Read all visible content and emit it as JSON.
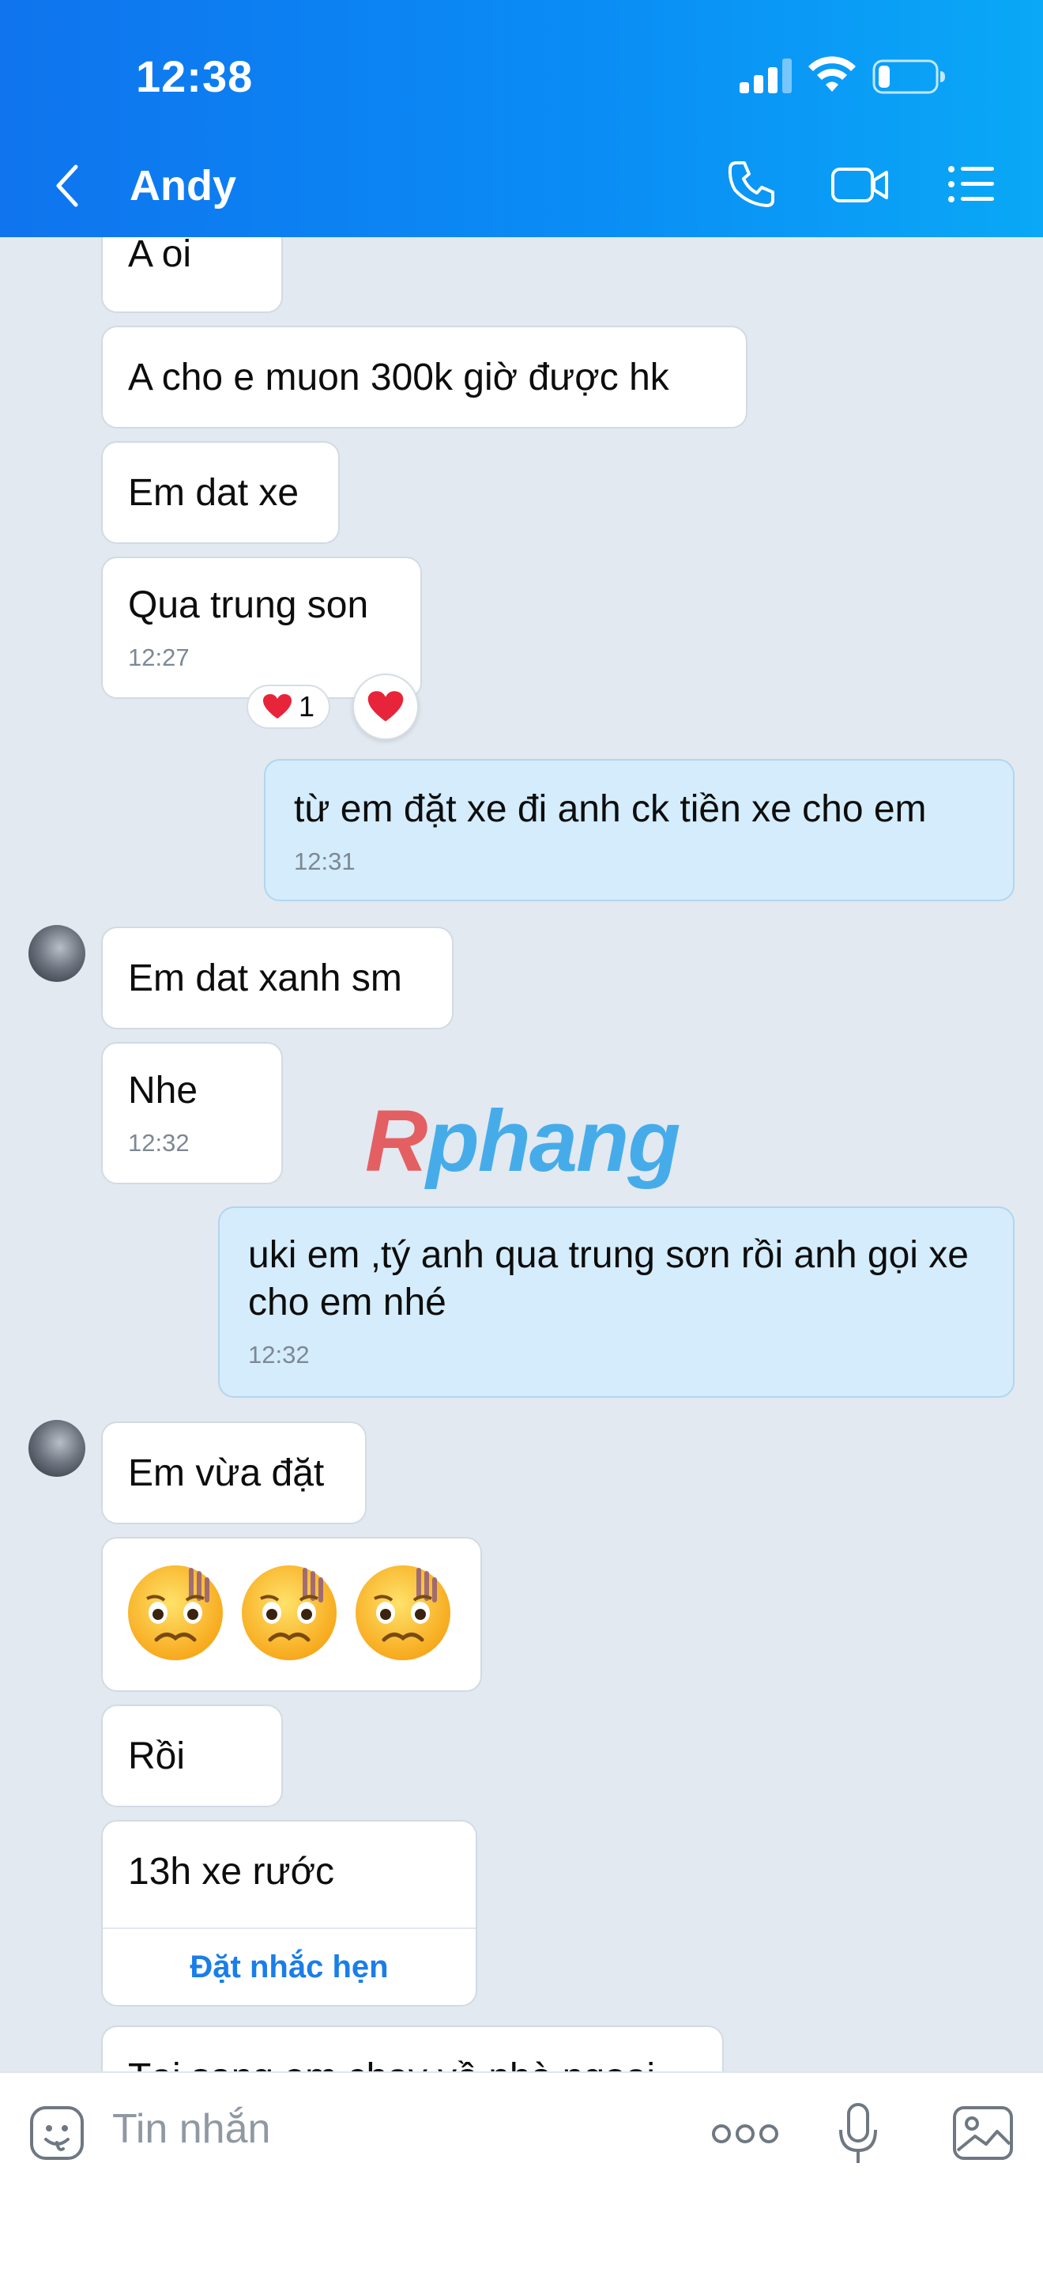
{
  "status_bar": {
    "time": "12:38"
  },
  "header": {
    "contact_name": "Andy"
  },
  "messages": [
    {
      "text": "A oi"
    },
    {
      "text": "A cho e muon 300k giờ được hk"
    },
    {
      "text": "Em dat xe"
    },
    {
      "text": "Qua trung son",
      "time": "12:27",
      "reaction_count": "1"
    },
    {
      "text": "từ em đặt xe đi anh ck tiền xe cho em",
      "time": "12:31"
    },
    {
      "text": "Em dat xanh sm"
    },
    {
      "text": "Nhe",
      "time": "12:32"
    },
    {
      "text": "uki em ,tý anh qua trung sơn rồi anh gọi xe cho em nhé",
      "time": "12:32"
    },
    {
      "text": "Em vừa đặt"
    },
    {
      "text": "Rồi"
    },
    {
      "text": "13h xe rước",
      "action": "Đặt nhắc hẹn"
    },
    {
      "text": "Tại sang em chạy về nhà ngoại"
    }
  ],
  "watermark": {
    "r": "R",
    "rest": "phang"
  },
  "composer": {
    "placeholder": "Tin nhắn"
  },
  "colors": {
    "header_start": "#0f74ee",
    "header_end": "#0aa8f6",
    "outgoing_bubble": "#d4ecfb",
    "incoming_bubble": "#ffffff",
    "chat_bg": "#e2e9f1",
    "link": "#1a7ee8"
  }
}
